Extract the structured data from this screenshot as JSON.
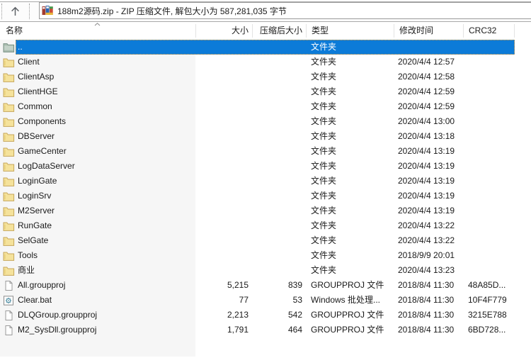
{
  "toolbar": {
    "up_tooltip": "up-one-level",
    "archive_title": "188m2源码.zip - ZIP 压缩文件, 解包大小为 587,281,035 字节"
  },
  "columns": [
    {
      "key": "name",
      "label": "名称"
    },
    {
      "key": "size",
      "label": "大小"
    },
    {
      "key": "packed",
      "label": "压缩后大小"
    },
    {
      "key": "type",
      "label": "类型"
    },
    {
      "key": "modified",
      "label": "修改时间"
    },
    {
      "key": "crc32",
      "label": "CRC32"
    }
  ],
  "sort": {
    "column": "名称",
    "direction": "ascending"
  },
  "colors": {
    "selection": "#0c7bd8",
    "selection_focus_dots": "#eda33f",
    "name_column_shade": "#f6f6f6",
    "folder_icon": "#f5e29b",
    "up_folder_icon": "#a9bcb0"
  },
  "rows": [
    {
      "name": "..",
      "icon": "up-folder",
      "type": "文件夹",
      "selected": true
    },
    {
      "name": "Client",
      "icon": "folder",
      "type": "文件夹",
      "modified": "2020/4/4 12:57"
    },
    {
      "name": "ClientAsp",
      "icon": "folder",
      "type": "文件夹",
      "modified": "2020/4/4 12:58"
    },
    {
      "name": "ClientHGE",
      "icon": "folder",
      "type": "文件夹",
      "modified": "2020/4/4 12:59"
    },
    {
      "name": "Common",
      "icon": "folder",
      "type": "文件夹",
      "modified": "2020/4/4 12:59"
    },
    {
      "name": "Components",
      "icon": "folder",
      "type": "文件夹",
      "modified": "2020/4/4 13:00"
    },
    {
      "name": "DBServer",
      "icon": "folder",
      "type": "文件夹",
      "modified": "2020/4/4 13:18"
    },
    {
      "name": "GameCenter",
      "icon": "folder",
      "type": "文件夹",
      "modified": "2020/4/4 13:19"
    },
    {
      "name": "LogDataServer",
      "icon": "folder",
      "type": "文件夹",
      "modified": "2020/4/4 13:19"
    },
    {
      "name": "LoginGate",
      "icon": "folder",
      "type": "文件夹",
      "modified": "2020/4/4 13:19"
    },
    {
      "name": "LoginSrv",
      "icon": "folder",
      "type": "文件夹",
      "modified": "2020/4/4 13:19"
    },
    {
      "name": "M2Server",
      "icon": "folder",
      "type": "文件夹",
      "modified": "2020/4/4 13:19"
    },
    {
      "name": "RunGate",
      "icon": "folder",
      "type": "文件夹",
      "modified": "2020/4/4 13:22"
    },
    {
      "name": "SelGate",
      "icon": "folder",
      "type": "文件夹",
      "modified": "2020/4/4 13:22"
    },
    {
      "name": "Tools",
      "icon": "folder",
      "type": "文件夹",
      "modified": "2018/9/9 20:01"
    },
    {
      "name": "商业",
      "icon": "folder",
      "type": "文件夹",
      "modified": "2020/4/4 13:23"
    },
    {
      "name": "All.groupproj",
      "icon": "file",
      "size": "5,215",
      "packed": "839",
      "type": "GROUPPROJ 文件",
      "modified": "2018/8/4 11:30",
      "crc32": "48A85D..."
    },
    {
      "name": "Clear.bat",
      "icon": "batch",
      "size": "77",
      "packed": "53",
      "type": "Windows 批处理...",
      "modified": "2018/8/4 11:30",
      "crc32": "10F4F779"
    },
    {
      "name": "DLQGroup.groupproj",
      "icon": "file",
      "size": "2,213",
      "packed": "542",
      "type": "GROUPPROJ 文件",
      "modified": "2018/8/4 11:30",
      "crc32": "3215E788"
    },
    {
      "name": "M2_SysDll.groupproj",
      "icon": "file",
      "size": "1,791",
      "packed": "464",
      "type": "GROUPPROJ 文件",
      "modified": "2018/8/4 11:30",
      "crc32": "6BD728..."
    }
  ]
}
